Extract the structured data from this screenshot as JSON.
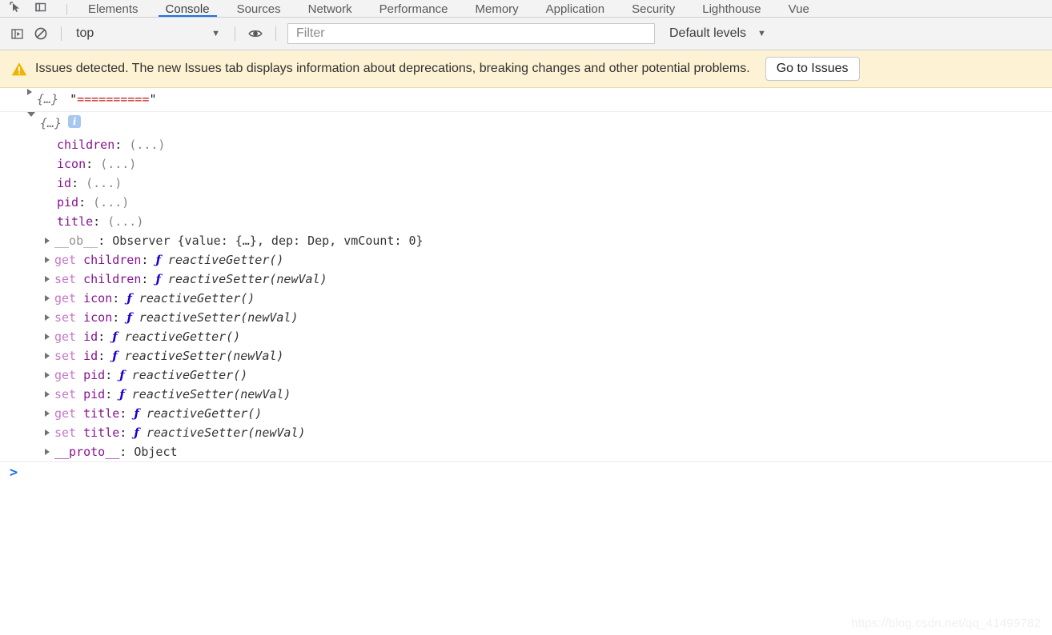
{
  "tabbar": {
    "inspect_icon": "inspect-cursor-icon",
    "device_icon": "device-toolbar-icon",
    "tabs": [
      {
        "label": "Elements",
        "active": false
      },
      {
        "label": "Console",
        "active": true
      },
      {
        "label": "Sources",
        "active": false
      },
      {
        "label": "Network",
        "active": false
      },
      {
        "label": "Performance",
        "active": false
      },
      {
        "label": "Memory",
        "active": false
      },
      {
        "label": "Application",
        "active": false
      },
      {
        "label": "Security",
        "active": false
      },
      {
        "label": "Lighthouse",
        "active": false
      },
      {
        "label": "Vue",
        "active": false
      }
    ]
  },
  "toolbar": {
    "sidebar_icon": "console-sidebar-icon",
    "clear_icon": "clear-console-icon",
    "context_selected": "top",
    "context_caret": "▼",
    "eye_icon": "live-expression-eye-icon",
    "filter_placeholder": "Filter",
    "filter_value": "",
    "levels_label": "Default levels",
    "levels_caret": "▼"
  },
  "issues_banner": {
    "icon": "warning-triangle-icon",
    "message": "Issues detected. The new Issues tab displays information about deprecations, breaking changes and other potential problems.",
    "button_label": "Go to Issues",
    "background": "#fdf3d4"
  },
  "console": {
    "messages": [
      {
        "id": "msg-string",
        "expanded": false,
        "object_preview": "{…}",
        "string_quote": "\"",
        "string_body": "==========",
        "string_color": "#c41a16"
      },
      {
        "id": "msg-object",
        "expanded": true,
        "object_preview": "{…}",
        "info_badge": "i"
      }
    ],
    "properties": [
      {
        "indent": 2,
        "arrow": false,
        "keyword": "",
        "key": "children",
        "key_style": "prop",
        "sep": ": ",
        "value": "(...)",
        "value_style": "gray"
      },
      {
        "indent": 2,
        "arrow": false,
        "keyword": "",
        "key": "icon",
        "key_style": "prop",
        "sep": ": ",
        "value": "(...)",
        "value_style": "gray"
      },
      {
        "indent": 2,
        "arrow": false,
        "keyword": "",
        "key": "id",
        "key_style": "prop",
        "sep": ": ",
        "value": "(...)",
        "value_style": "gray"
      },
      {
        "indent": 2,
        "arrow": false,
        "keyword": "",
        "key": "pid",
        "key_style": "prop",
        "sep": ": ",
        "value": "(...)",
        "value_style": "gray"
      },
      {
        "indent": 2,
        "arrow": false,
        "keyword": "",
        "key": "title",
        "key_style": "prop",
        "sep": ": ",
        "value": "(...)",
        "value_style": "gray"
      },
      {
        "indent": 1,
        "arrow": true,
        "keyword": "",
        "key": "__ob__",
        "key_style": "dim",
        "sep": ": ",
        "value": "Observer {value: {…}, dep: Dep, vmCount: 0}",
        "value_style": "observer"
      },
      {
        "indent": 1,
        "arrow": true,
        "keyword": "get",
        "key": "children",
        "key_style": "prop",
        "sep": ": ",
        "value": "reactiveGetter()",
        "value_style": "fn"
      },
      {
        "indent": 1,
        "arrow": true,
        "keyword": "set",
        "key": "children",
        "key_style": "prop",
        "sep": ": ",
        "value": "reactiveSetter(newVal)",
        "value_style": "fn"
      },
      {
        "indent": 1,
        "arrow": true,
        "keyword": "get",
        "key": "icon",
        "key_style": "prop",
        "sep": ": ",
        "value": "reactiveGetter()",
        "value_style": "fn"
      },
      {
        "indent": 1,
        "arrow": true,
        "keyword": "set",
        "key": "icon",
        "key_style": "prop",
        "sep": ": ",
        "value": "reactiveSetter(newVal)",
        "value_style": "fn"
      },
      {
        "indent": 1,
        "arrow": true,
        "keyword": "get",
        "key": "id",
        "key_style": "prop",
        "sep": ": ",
        "value": "reactiveGetter()",
        "value_style": "fn"
      },
      {
        "indent": 1,
        "arrow": true,
        "keyword": "set",
        "key": "id",
        "key_style": "prop",
        "sep": ": ",
        "value": "reactiveSetter(newVal)",
        "value_style": "fn"
      },
      {
        "indent": 1,
        "arrow": true,
        "keyword": "get",
        "key": "pid",
        "key_style": "prop",
        "sep": ": ",
        "value": "reactiveGetter()",
        "value_style": "fn"
      },
      {
        "indent": 1,
        "arrow": true,
        "keyword": "set",
        "key": "pid",
        "key_style": "prop",
        "sep": ": ",
        "value": "reactiveSetter(newVal)",
        "value_style": "fn"
      },
      {
        "indent": 1,
        "arrow": true,
        "keyword": "get",
        "key": "title",
        "key_style": "prop",
        "sep": ": ",
        "value": "reactiveGetter()",
        "value_style": "fn"
      },
      {
        "indent": 1,
        "arrow": true,
        "keyword": "set",
        "key": "title",
        "key_style": "prop",
        "sep": ": ",
        "value": "reactiveSetter(newVal)",
        "value_style": "fn"
      },
      {
        "indent": 1,
        "arrow": true,
        "keyword": "",
        "key": "__proto__",
        "key_style": "prop",
        "sep": ": ",
        "value": "Object",
        "value_style": "plain"
      }
    ],
    "prompt_caret": ">",
    "prompt_value": ""
  },
  "watermark": "https://blog.csdn.net/qq_41499782"
}
